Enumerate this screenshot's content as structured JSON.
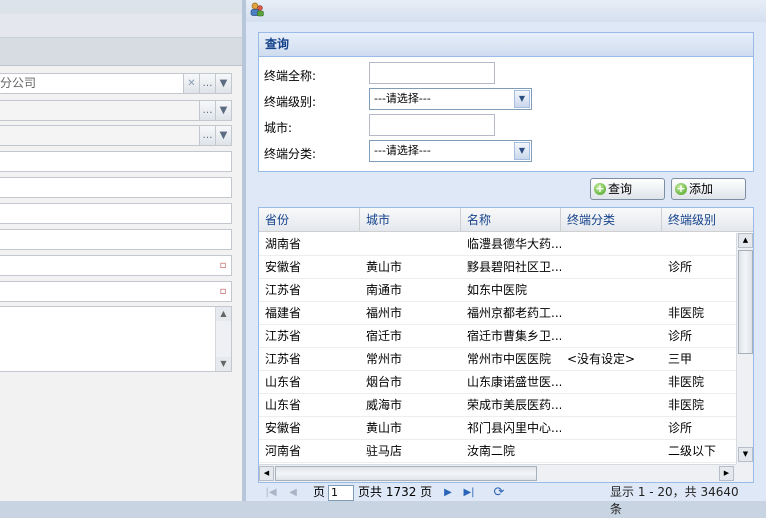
{
  "background_form": {
    "company_field_value": "分公司"
  },
  "dialog": {
    "query": {
      "title": "查询",
      "fields": [
        {
          "label": "终端全称:",
          "type": "text",
          "value": ""
        },
        {
          "label": "终端级别:",
          "type": "select",
          "value": "---请选择---"
        },
        {
          "label": "城市:",
          "type": "text",
          "value": ""
        },
        {
          "label": "终端分类:",
          "type": "select",
          "value": "---请选择---"
        }
      ]
    },
    "buttons": {
      "search": "查询",
      "add": "添加"
    },
    "grid": {
      "columns": [
        "省份",
        "城市",
        "名称",
        "终端分类",
        "终端级别"
      ],
      "rows": [
        [
          "湖南省",
          "",
          "临澧县德华大药...",
          "",
          ""
        ],
        [
          "安徽省",
          "黄山市",
          "黟县碧阳社区卫...",
          "",
          "诊所"
        ],
        [
          "江苏省",
          "南通市",
          "如东中医院",
          "",
          ""
        ],
        [
          "福建省",
          "福州市",
          "福州京都老药工...",
          "",
          "非医院"
        ],
        [
          "江苏省",
          "宿迁市",
          "宿迁市曹集乡卫...",
          "",
          "诊所"
        ],
        [
          "江苏省",
          "常州市",
          "常州市中医医院",
          "<没有设定>",
          "三甲"
        ],
        [
          "山东省",
          "烟台市",
          "山东康诺盛世医...",
          "",
          "非医院"
        ],
        [
          "山东省",
          "威海市",
          "荣成市美辰医药...",
          "",
          "非医院"
        ],
        [
          "安徽省",
          "黄山市",
          "祁门县闪里中心...",
          "",
          "诊所"
        ],
        [
          "河南省",
          "驻马店",
          "汝南二院",
          "",
          "二级以下"
        ]
      ]
    },
    "pager": {
      "page_label": "页",
      "current_page": "1",
      "total_text": "页共 1732 页",
      "display_text": "显示 1 - 20，共 34640 条"
    }
  }
}
